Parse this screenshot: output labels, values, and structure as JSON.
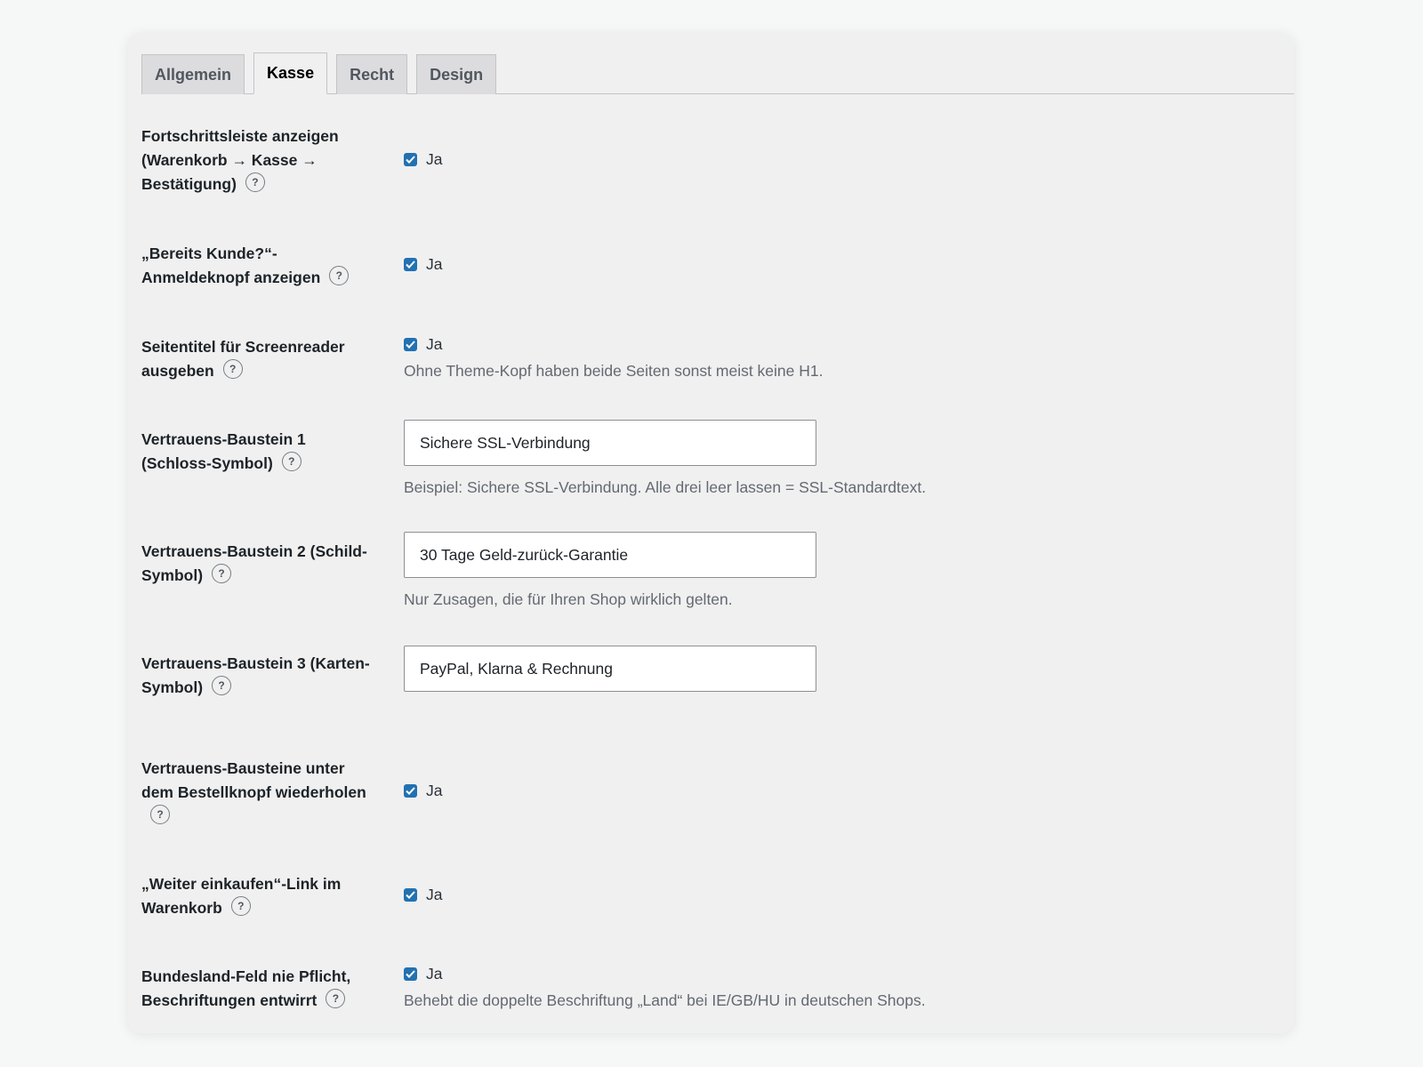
{
  "tabs": [
    "Allgemein",
    "Kasse",
    "Recht",
    "Design"
  ],
  "active_tab": "Kasse",
  "help_glyph": "?",
  "settings": [
    {
      "label": "Fortschrittsleiste anzeigen (Warenkorb → Kasse → Bestätigung)",
      "type": "checkbox",
      "checked": true,
      "option_label": "Ja"
    },
    {
      "label": "„Bereits Kunde?“-Anmeldeknopf anzeigen",
      "type": "checkbox",
      "checked": true,
      "option_label": "Ja"
    },
    {
      "label": "Seitentitel für Screenreader ausgeben",
      "type": "checkbox",
      "checked": true,
      "option_label": "Ja",
      "description": "Ohne Theme-Kopf haben beide Seiten sonst meist keine H1."
    },
    {
      "label": "Vertrauens-Baustein 1 (Schloss-Symbol)",
      "type": "text",
      "value": "Sichere SSL-Verbindung",
      "description": "Beispiel: Sichere SSL-Verbindung. Alle drei leer lassen = SSL-Standardtext."
    },
    {
      "label": "Vertrauens-Baustein 2 (Schild-Symbol)",
      "type": "text",
      "value": "30 Tage Geld-zurück-Garantie",
      "description": "Nur Zusagen, die für Ihren Shop wirklich gelten."
    },
    {
      "label": "Vertrauens-Baustein 3 (Karten-Symbol)",
      "type": "text",
      "value": "PayPal, Klarna & Rechnung"
    },
    {
      "label": "Vertrauens-Bausteine unter dem Bestellknopf wiederholen",
      "type": "checkbox",
      "checked": true,
      "option_label": "Ja"
    },
    {
      "label": "„Weiter einkaufen“-Link im Warenkorb",
      "type": "checkbox",
      "checked": true,
      "option_label": "Ja"
    },
    {
      "label": "Bundesland-Feld nie Pflicht, Beschriftungen entwirrt",
      "type": "checkbox",
      "checked": true,
      "option_label": "Ja",
      "description": "Behebt die doppelte Beschriftung „Land“ bei IE/GB/HU in deutschen Shops."
    }
  ],
  "colors": {
    "checkbox": "#2271b1",
    "description": "#646970",
    "panel": "#f0f0f1"
  }
}
